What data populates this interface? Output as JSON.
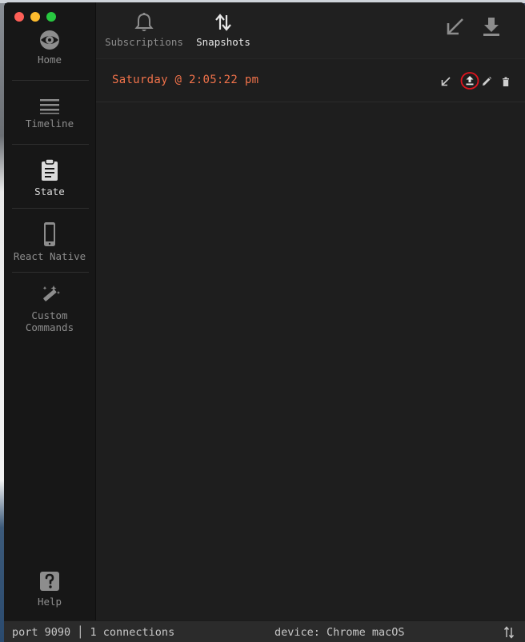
{
  "sidebar": {
    "items": [
      {
        "label": "Home",
        "icon": "eye-icon"
      },
      {
        "label": "Timeline",
        "icon": "timeline-icon"
      },
      {
        "label": "State",
        "icon": "clipboard-icon"
      },
      {
        "label": "React Native",
        "icon": "phone-icon"
      },
      {
        "label_line1": "Custom",
        "label_line2": "Commands",
        "icon": "magic-wand-icon"
      }
    ],
    "help": {
      "label": "Help",
      "icon": "help-icon"
    }
  },
  "header": {
    "tabs": [
      {
        "label": "Subscriptions",
        "icon": "bell-icon"
      },
      {
        "label": "Snapshots",
        "icon": "swap-vertical-icon"
      }
    ]
  },
  "snapshots": [
    {
      "name": "Saturday @ 2:05:22 pm"
    }
  ],
  "statusbar": {
    "port_text": "port 9090 │ 1 connections",
    "device_text": "device: Chrome macOS"
  },
  "colors": {
    "accent": "#f0724a",
    "background": "#1e1e1e",
    "sidebar": "#171717",
    "annotation_circle": "#e0141e"
  }
}
